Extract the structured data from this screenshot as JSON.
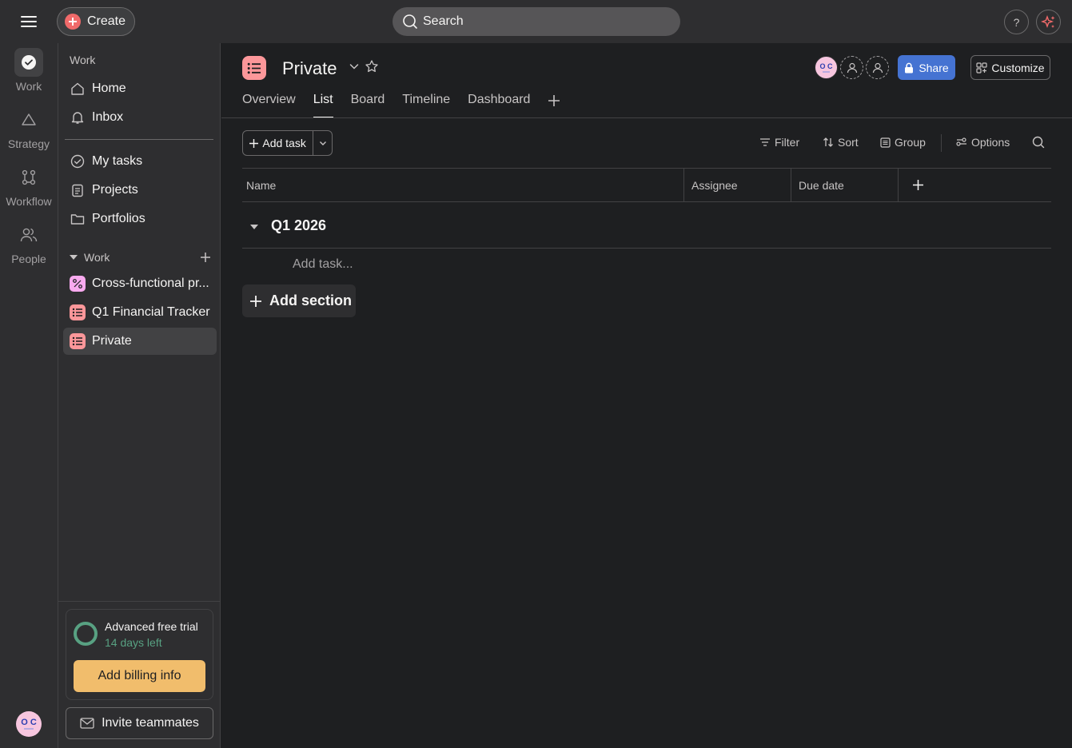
{
  "topbar": {
    "create_label": "Create",
    "search_placeholder": "Search",
    "help_label": "?"
  },
  "rail": {
    "items": [
      {
        "label": "Work",
        "icon": "check-circle-icon",
        "active": true
      },
      {
        "label": "Strategy",
        "icon": "triangle-icon"
      },
      {
        "label": "Workflow",
        "icon": "workflow-icon"
      },
      {
        "label": "People",
        "icon": "people-icon"
      }
    ],
    "avatar_initials": "O C"
  },
  "sidebar": {
    "heading": "Work",
    "nav": [
      {
        "label": "Home",
        "icon": "home-icon"
      },
      {
        "label": "Inbox",
        "icon": "bell-icon"
      }
    ],
    "nav2": [
      {
        "label": "My tasks",
        "icon": "check-circle-icon"
      },
      {
        "label": "Projects",
        "icon": "clipboard-icon"
      },
      {
        "label": "Portfolios",
        "icon": "folder-icon"
      }
    ],
    "section_label": "Work",
    "projects": [
      {
        "label": "Cross-functional pr...",
        "icon": "workflow-project-icon"
      },
      {
        "label": "Q1 Financial Tracker",
        "icon": "list-project-icon"
      },
      {
        "label": "Private",
        "icon": "list-project-icon",
        "active": true
      }
    ],
    "trial": {
      "title": "Advanced free trial",
      "subtitle": "14 days left",
      "billing_label": "Add billing info"
    },
    "invite_label": "Invite teammates"
  },
  "project": {
    "title": "Private",
    "members_initials": "O C",
    "share_label": "Share",
    "customize_label": "Customize",
    "tabs": [
      "Overview",
      "List",
      "Board",
      "Timeline",
      "Dashboard"
    ],
    "active_tab": "List"
  },
  "toolbar": {
    "add_task_label": "Add task",
    "filter_label": "Filter",
    "sort_label": "Sort",
    "group_label": "Group",
    "options_label": "Options"
  },
  "grid": {
    "columns": [
      "Name",
      "Assignee",
      "Due date"
    ]
  },
  "section": {
    "title": "Q1 2026",
    "add_task_placeholder": "Add task...",
    "add_section_label": "Add section"
  },
  "colors": {
    "brand_coral": "#f06a6a",
    "share_blue": "#4573d2",
    "billing_orange": "#f1bd6c",
    "trial_green": "#58a182",
    "project_pink": "#fc979a"
  }
}
